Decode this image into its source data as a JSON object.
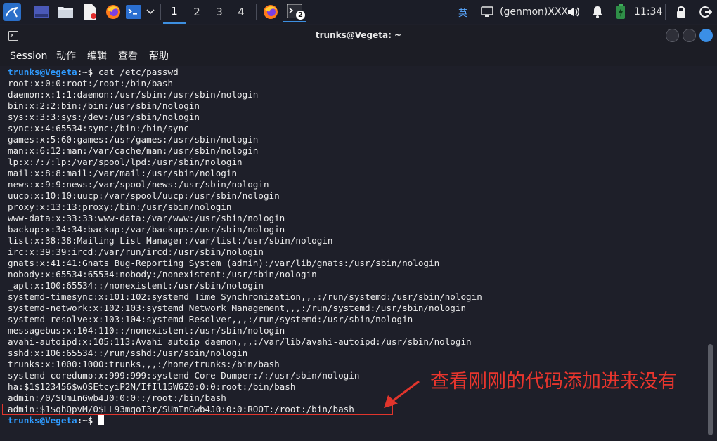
{
  "taskbar": {
    "workspaces": [
      "1",
      "2",
      "3",
      "4"
    ],
    "active_workspace": "1",
    "terminal_badge": "2",
    "ime": "英",
    "genmon": "(genmon)XXX",
    "clock": "11:34",
    "icons": [
      "kali-menu-icon",
      "desktop-icon",
      "file-manager-icon",
      "text-editor-icon",
      "firefox-icon",
      "terminal-icon",
      "dropdown-icon",
      "firefox-task-icon",
      "terminal-task-icon",
      "monitor-icon",
      "volume-icon",
      "notification-bell-icon",
      "battery-icon",
      "lock-icon",
      "logout-icon"
    ]
  },
  "window": {
    "title": "trunks@Vegeta: ~",
    "menu": [
      "Session",
      "动作",
      "编辑",
      "查看",
      "帮助"
    ]
  },
  "terminal": {
    "prompt_user": "trunks@Vegeta",
    "prompt_path": ":~$ ",
    "command": "cat /etc/passwd",
    "output": [
      "root:x:0:0:root:/root:/bin/bash",
      "daemon:x:1:1:daemon:/usr/sbin:/usr/sbin/nologin",
      "bin:x:2:2:bin:/bin:/usr/sbin/nologin",
      "sys:x:3:3:sys:/dev:/usr/sbin/nologin",
      "sync:x:4:65534:sync:/bin:/bin/sync",
      "games:x:5:60:games:/usr/games:/usr/sbin/nologin",
      "man:x:6:12:man:/var/cache/man:/usr/sbin/nologin",
      "lp:x:7:7:lp:/var/spool/lpd:/usr/sbin/nologin",
      "mail:x:8:8:mail:/var/mail:/usr/sbin/nologin",
      "news:x:9:9:news:/var/spool/news:/usr/sbin/nologin",
      "uucp:x:10:10:uucp:/var/spool/uucp:/usr/sbin/nologin",
      "proxy:x:13:13:proxy:/bin:/usr/sbin/nologin",
      "www-data:x:33:33:www-data:/var/www:/usr/sbin/nologin",
      "backup:x:34:34:backup:/var/backups:/usr/sbin/nologin",
      "list:x:38:38:Mailing List Manager:/var/list:/usr/sbin/nologin",
      "irc:x:39:39:ircd:/var/run/ircd:/usr/sbin/nologin",
      "gnats:x:41:41:Gnats Bug-Reporting System (admin):/var/lib/gnats:/usr/sbin/nologin",
      "nobody:x:65534:65534:nobody:/nonexistent:/usr/sbin/nologin",
      "_apt:x:100:65534::/nonexistent:/usr/sbin/nologin",
      "systemd-timesync:x:101:102:systemd Time Synchronization,,,:/run/systemd:/usr/sbin/nologin",
      "systemd-network:x:102:103:systemd Network Management,,,:/run/systemd:/usr/sbin/nologin",
      "systemd-resolve:x:103:104:systemd Resolver,,,:/run/systemd:/usr/sbin/nologin",
      "messagebus:x:104:110::/nonexistent:/usr/sbin/nologin",
      "avahi-autoipd:x:105:113:Avahi autoip daemon,,,:/var/lib/avahi-autoipd:/usr/sbin/nologin",
      "sshd:x:106:65534::/run/sshd:/usr/sbin/nologin",
      "trunks:x:1000:1000:trunks,,,:/home/trunks:/bin/bash",
      "systemd-coredump:x:999:999:systemd Core Dumper:/:/usr/sbin/nologin",
      "ha:$1$123456$wOSEtcyiP2N/IfIl15W6Z0:0:0:root:/bin/bash",
      "admin:/0/SUmInGwb4J0:0:0::/root:/bin/bash",
      "admin:$1$qhQpvM/0$LL93mqoI3r/SUmInGwb4J0:0:0:ROOT:/root:/bin/bash"
    ]
  },
  "annotation": {
    "text": "查看刚刚的代码添加进来没有",
    "color": "#e8352d"
  },
  "colors": {
    "prompt_user": "#2f9bff",
    "background": "#1e1f29",
    "taskbar": "#1b1d27",
    "accent": "#3d8fe0"
  }
}
